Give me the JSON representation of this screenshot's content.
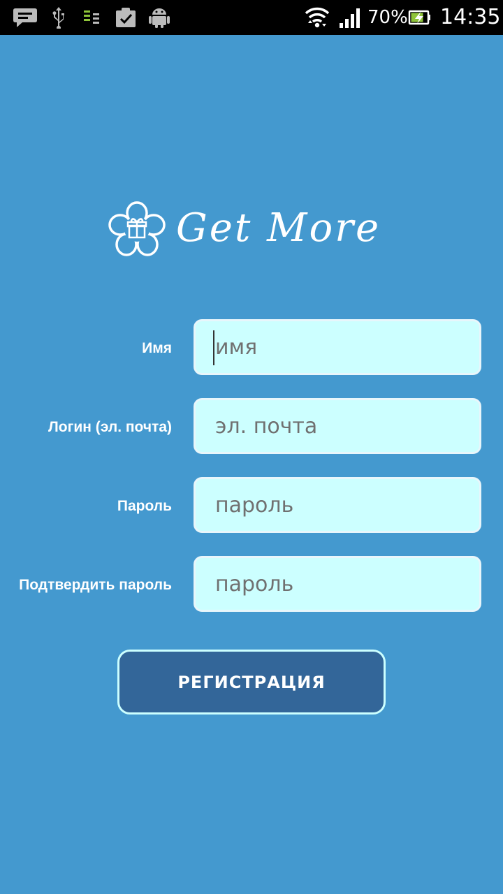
{
  "status_bar": {
    "icons_left": [
      "message-icon",
      "usb-icon",
      "data-sync-icon",
      "clipboard-check-icon",
      "android-debug-icon"
    ],
    "icons_right": [
      "wifi-icon",
      "signal-icon",
      "battery-charging-icon"
    ],
    "battery_text": "70%",
    "time": "14:35"
  },
  "logo": {
    "text": "Get More",
    "icon": "flower-gift-icon"
  },
  "form": {
    "name_label": "Имя",
    "name_placeholder": "имя",
    "login_label": "Логин (эл. почта)",
    "login_placeholder": "эл. почта",
    "password_label": "Пароль",
    "password_placeholder": "пароль",
    "confirm_label": "Подтвердить пароль",
    "confirm_placeholder": "пароль",
    "register_button": "РЕГИСТРАЦИЯ"
  },
  "colors": {
    "background": "#4499cf",
    "field_fill": "#ccffff",
    "button_fill": "#336699",
    "status_bar": "#000000"
  }
}
